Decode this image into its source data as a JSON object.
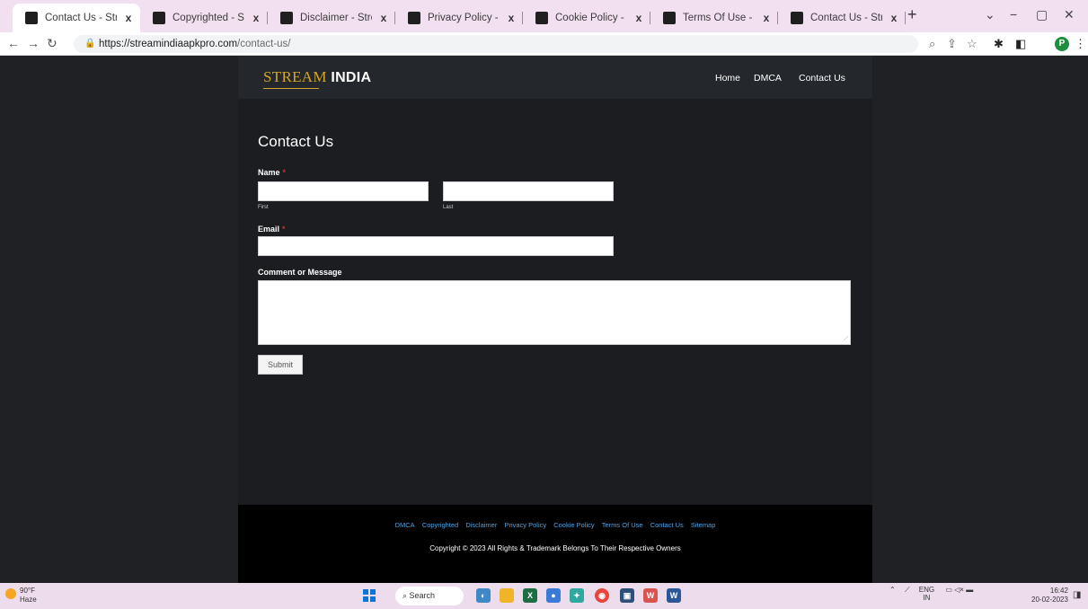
{
  "browser": {
    "tabs": [
      {
        "title": "Contact Us - Stream I",
        "active": true
      },
      {
        "title": "Copyrighted - Stream",
        "active": false
      },
      {
        "title": "Disclaimer - Stream I",
        "active": false
      },
      {
        "title": "Privacy Policy - Strea",
        "active": false
      },
      {
        "title": "Cookie Policy - Strea",
        "active": false
      },
      {
        "title": "Terms Of Use - Strea",
        "active": false
      },
      {
        "title": "Contact Us - Stream I",
        "active": false
      }
    ],
    "tab_close_glyph": "x",
    "new_tab_glyph": "+",
    "url_host": "https://streamindiaapkpro.com",
    "url_path": "/contact-us/",
    "profile_initial": "P"
  },
  "site": {
    "logo_part1": "STREAM",
    "logo_part2": "INDIA",
    "nav": [
      "Home",
      "DMCA",
      "Contact Us"
    ],
    "accent_color": "#d4a62a"
  },
  "form": {
    "title": "Contact Us",
    "name_label": "Name",
    "name_first_sublabel": "First",
    "name_last_sublabel": "Last",
    "email_label": "Email",
    "message_label": "Comment or Message",
    "required_marker": "*",
    "submit_label": "Submit"
  },
  "footer": {
    "links": [
      "DMCA",
      "Copyrighted",
      "Disclaimer",
      "Privacy Policy",
      "Cookie Policy",
      "Terms Of Use",
      "Contact Us",
      "Sitemap"
    ],
    "copyright": "Copyright © 2023 All Rights & Trademark Belongs To Their Respective Owners",
    "link_color": "#4fa3e0"
  },
  "taskbar": {
    "weather_temp": "90°F",
    "weather_desc": "Haze",
    "search_label": "Search",
    "lang_line1": "ENG",
    "lang_line2": "IN",
    "time": "16:42",
    "date": "20-02-2023"
  }
}
